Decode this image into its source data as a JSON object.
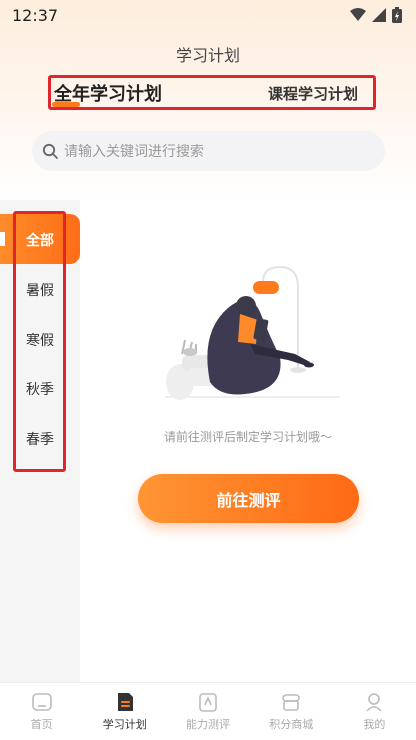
{
  "status_bar": {
    "time": "12:37"
  },
  "header": {
    "title": "学习计划"
  },
  "tabs": [
    {
      "label": "全年学习计划",
      "active": true
    },
    {
      "label": "课程学习计划",
      "active": false
    }
  ],
  "search": {
    "placeholder": "请输入关键词进行搜索"
  },
  "sidebar": {
    "items": [
      {
        "label": "全部",
        "active": true
      },
      {
        "label": "暑假"
      },
      {
        "label": "寒假"
      },
      {
        "label": "秋季"
      },
      {
        "label": "春季"
      }
    ]
  },
  "empty_state": {
    "hint": "请前往测评后制定学习计划哦～",
    "button_label": "前往测评"
  },
  "bottom_nav": {
    "items": [
      {
        "label": "首页",
        "icon": "home-icon"
      },
      {
        "label": "学习计划",
        "icon": "study-plan-icon",
        "active": true
      },
      {
        "label": "能力测评",
        "icon": "assessment-icon"
      },
      {
        "label": "积分商城",
        "icon": "points-mall-icon"
      },
      {
        "label": "我的",
        "icon": "profile-icon"
      }
    ]
  },
  "colors": {
    "accent": "#ff7a1a",
    "highlight_border": "#e0262b"
  }
}
